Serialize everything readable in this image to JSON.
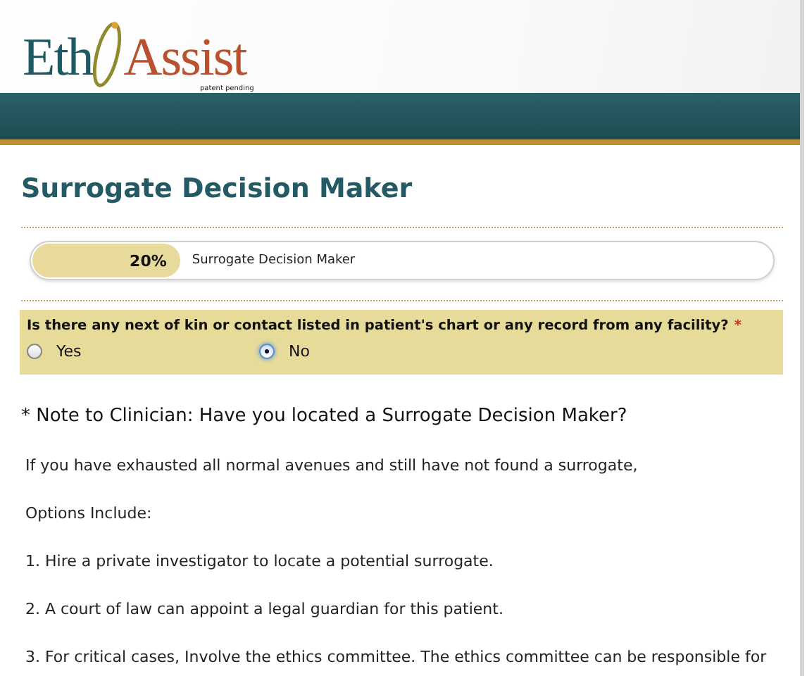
{
  "header": {
    "logo": {
      "first": "Eth",
      "second": "Assist",
      "tagline": "patent pending"
    }
  },
  "page_title": "Surrogate Decision Maker",
  "progress": {
    "level": 0.2,
    "reading": "20%",
    "label": "Surrogate Decision Maker"
  },
  "question": {
    "text": "Is there any next of kin or contact listed in patient's chart or any record from any facility?",
    "required_mark": "*",
    "options": [
      {
        "label": "Yes",
        "selected": false
      },
      {
        "label": "No",
        "selected": true
      }
    ]
  },
  "note": "* Note to Clinician: Have you located a Surrogate Decision Maker?",
  "paragraphs": [
    "If you have exhausted all normal avenues and still have not found a surrogate,",
    "Options Include:",
    "1. Hire a private investigator to locate a potential surrogate.",
    "2. A court of law can appoint a legal guardian for this patient.",
    "3. For critical cases, Involve the ethics committee. The ethics committee can be responsible for"
  ]
}
